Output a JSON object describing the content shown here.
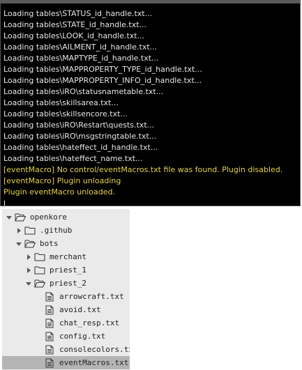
{
  "console": {
    "lines": [
      {
        "text": "Loading tables\\STATUS_id_handle.txt...",
        "kind": "normal"
      },
      {
        "text": "Loading tables\\STATE_id_handle.txt...",
        "kind": "normal"
      },
      {
        "text": "Loading tables\\LOOK_id_handle.txt...",
        "kind": "normal"
      },
      {
        "text": "Loading tables\\AILMENT_id_handle.txt...",
        "kind": "normal"
      },
      {
        "text": "Loading tables\\MAPTYPE_id_handle.txt...",
        "kind": "normal"
      },
      {
        "text": "Loading tables\\MAPPROPERTY_TYPE_id_handle.txt...",
        "kind": "normal"
      },
      {
        "text": "Loading tables\\MAPPROPERTY_INFO_id_handle.txt...",
        "kind": "normal"
      },
      {
        "text": "Loading tables\\iRO\\statusnametable.txt...",
        "kind": "normal"
      },
      {
        "text": "Loading tables\\skillsarea.txt...",
        "kind": "normal"
      },
      {
        "text": "Loading tables\\skillsencore.txt...",
        "kind": "normal"
      },
      {
        "text": "Loading tables\\iRO\\Restart\\quests.txt...",
        "kind": "normal"
      },
      {
        "text": "Loading tables\\iRO\\msgstringtable.txt...",
        "kind": "normal"
      },
      {
        "text": "Loading tables\\hateffect_id_handle.txt...",
        "kind": "normal"
      },
      {
        "text": "Loading tables\\hateffect_name.txt...",
        "kind": "normal"
      },
      {
        "text": "[eventMacro] No control/eventMacros.txt file was found. Plugin disabled.",
        "kind": "warn"
      },
      {
        "text": "[eventMacro] Plugin unloading",
        "kind": "warn"
      },
      {
        "text": "Plugin eventMacro unloaded.",
        "kind": "warn"
      }
    ]
  },
  "tree": {
    "items": [
      {
        "label": "openkore",
        "type": "folder",
        "indent": 0,
        "expanded": true,
        "selected": false,
        "icon": "folder-open-icon"
      },
      {
        "label": ".github",
        "type": "folder",
        "indent": 1,
        "expanded": false,
        "selected": false,
        "icon": "folder-icon"
      },
      {
        "label": "bots",
        "type": "folder",
        "indent": 1,
        "expanded": true,
        "selected": false,
        "icon": "folder-open-icon"
      },
      {
        "label": "merchant",
        "type": "folder",
        "indent": 2,
        "expanded": false,
        "selected": false,
        "icon": "folder-icon"
      },
      {
        "label": "priest_1",
        "type": "folder",
        "indent": 2,
        "expanded": false,
        "selected": false,
        "icon": "folder-icon"
      },
      {
        "label": "priest_2",
        "type": "folder",
        "indent": 2,
        "expanded": true,
        "selected": false,
        "icon": "folder-open-icon"
      },
      {
        "label": "arrowcraft.txt",
        "type": "file",
        "indent": 3,
        "selected": false,
        "icon": "file-icon"
      },
      {
        "label": "avoid.txt",
        "type": "file",
        "indent": 3,
        "selected": false,
        "icon": "file-icon"
      },
      {
        "label": "chat_resp.txt",
        "type": "file",
        "indent": 3,
        "selected": false,
        "icon": "file-icon"
      },
      {
        "label": "config.txt",
        "type": "file",
        "indent": 3,
        "selected": false,
        "icon": "file-icon"
      },
      {
        "label": "consolecolors.txt",
        "type": "file",
        "indent": 3,
        "selected": false,
        "icon": "file-icon"
      },
      {
        "label": "eventMacros.txt",
        "type": "file",
        "indent": 3,
        "selected": true,
        "icon": "file-icon"
      }
    ]
  },
  "colors": {
    "console_bg": "#000000",
    "console_text": "#e8e8e8",
    "console_warn": "#e6d34a",
    "tree_bg": "#eaeaea",
    "tree_selected": "#b4b4b4"
  }
}
